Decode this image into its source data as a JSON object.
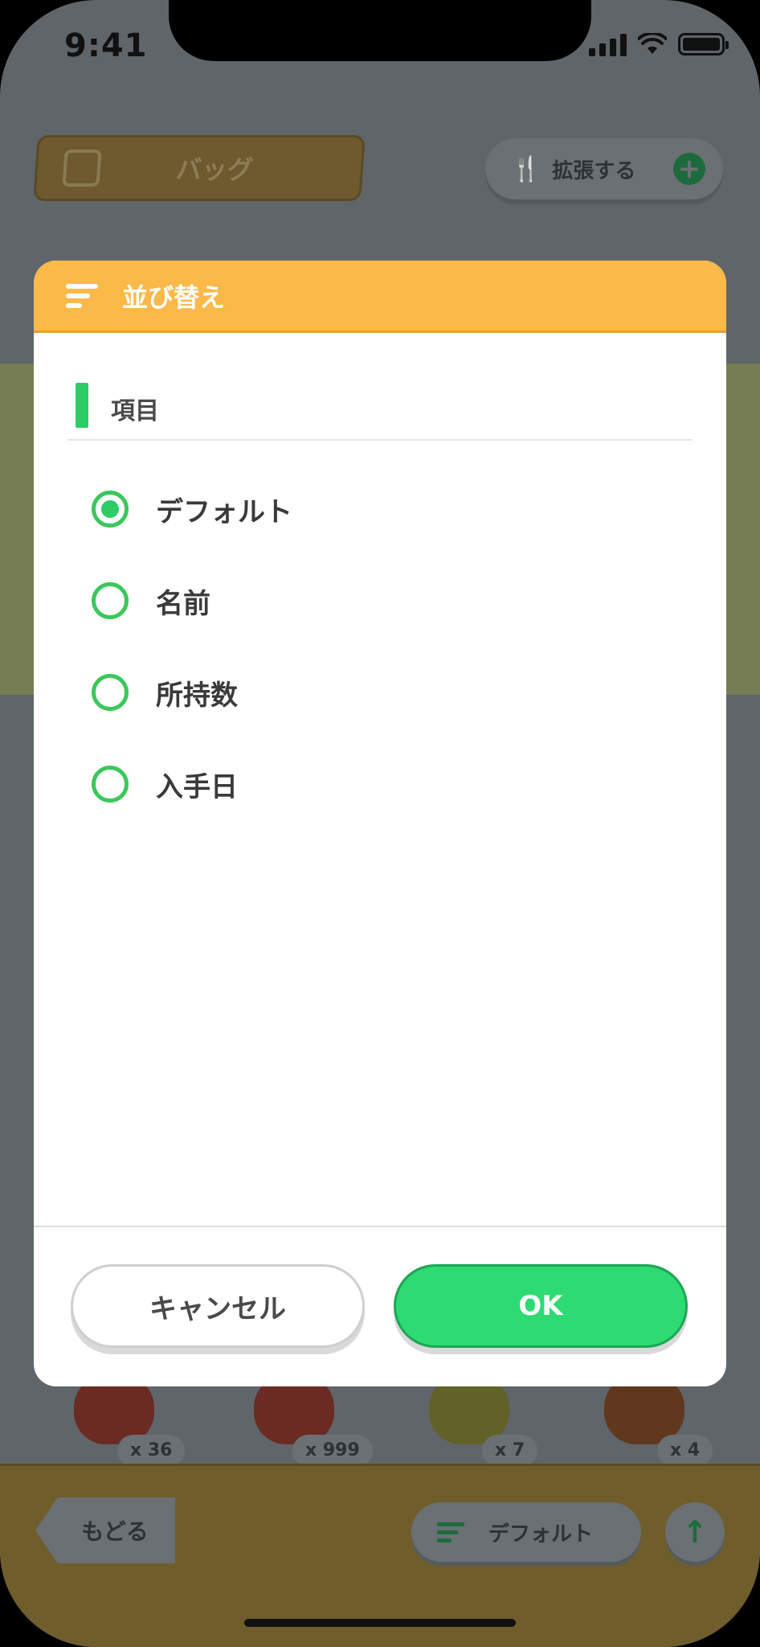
{
  "status_bar": {
    "time": "9:41"
  },
  "background": {
    "bag_label": "バッグ",
    "expand_label": "拡張する",
    "items": [
      {
        "count": "x 36",
        "color": "#7a2a20"
      },
      {
        "count": "x 999",
        "color": "#7a2a20"
      },
      {
        "count": "x 7",
        "color": "#6a6a28"
      },
      {
        "count": "x 4",
        "color": "#6a3a20"
      }
    ],
    "back_label": "もどる",
    "sort_chip_label": "デフォルト"
  },
  "modal": {
    "title": "並び替え",
    "section_label": "項目",
    "options": [
      {
        "label": "デフォルト",
        "selected": true
      },
      {
        "label": "名前",
        "selected": false
      },
      {
        "label": "所持数",
        "selected": false
      },
      {
        "label": "入手日",
        "selected": false
      }
    ],
    "cancel_label": "キャンセル",
    "ok_label": "OK"
  },
  "colors": {
    "header": "#fbb94a",
    "accent_green": "#2ecc66",
    "overlay": "#5f6569"
  }
}
